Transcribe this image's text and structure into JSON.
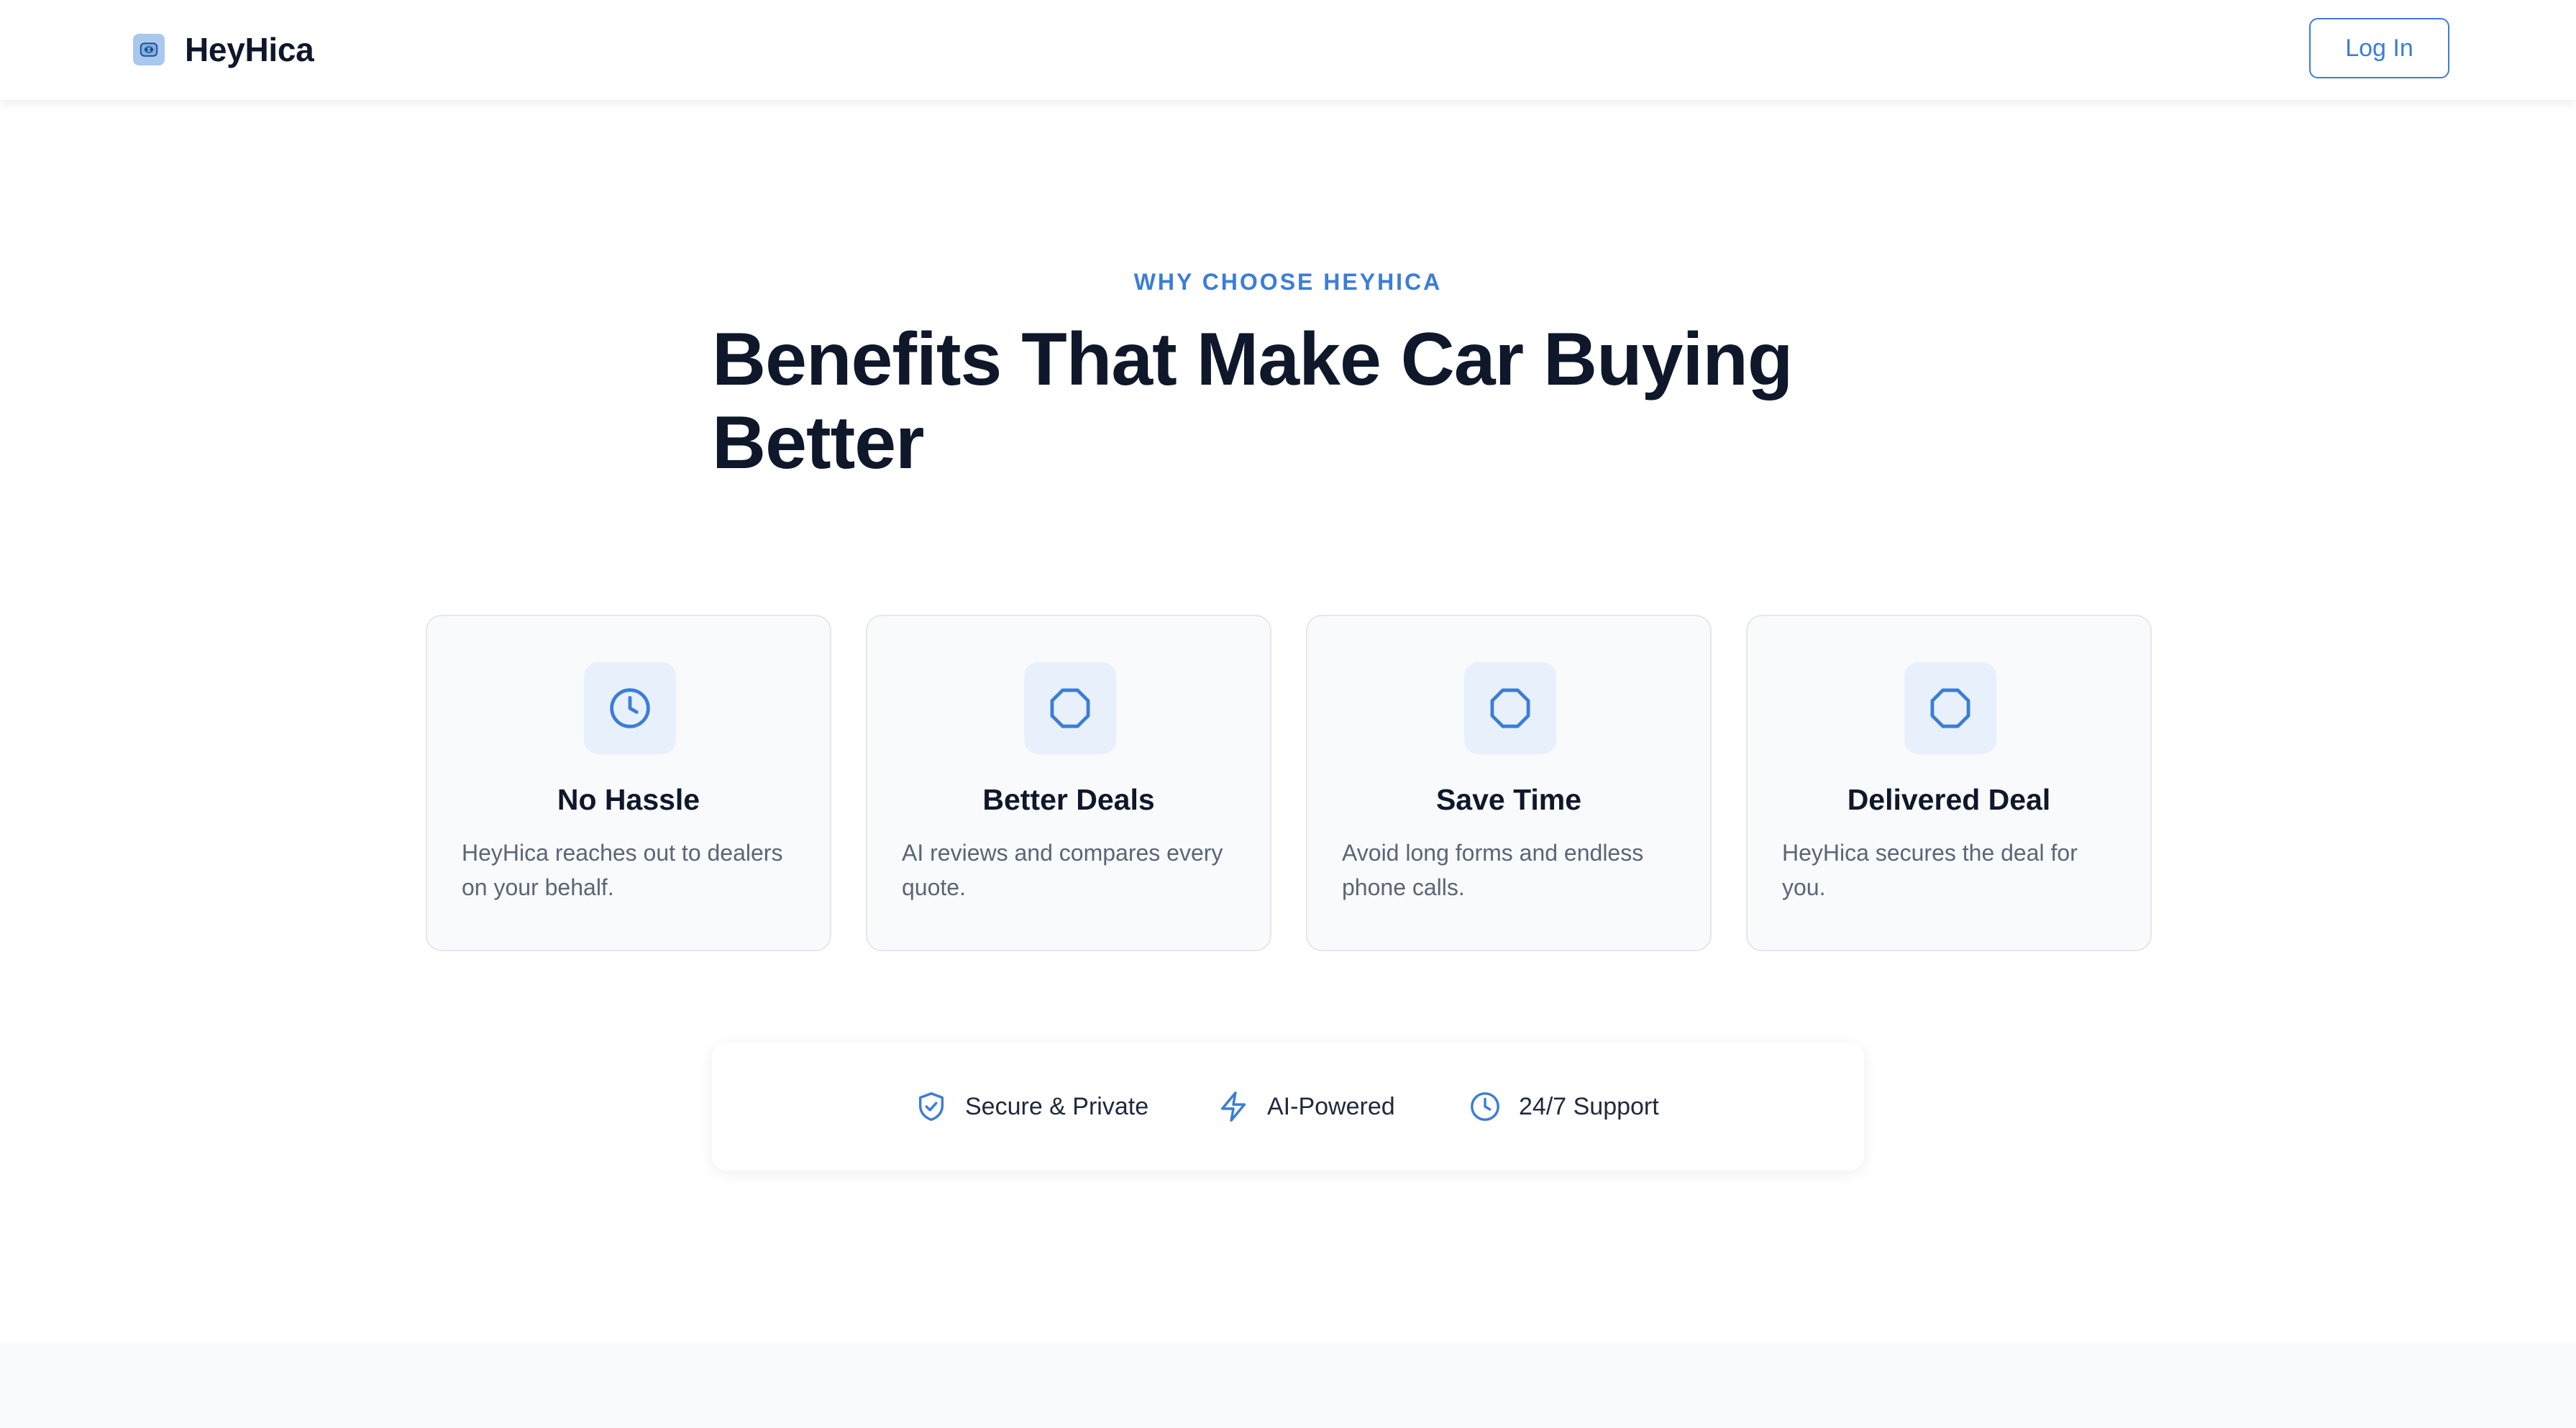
{
  "header": {
    "brand_name": "HeyHica",
    "login_label": "Log In"
  },
  "hero": {
    "eyebrow": "WHY CHOOSE HEYHICA",
    "headline_line1": "Benefits That Make Car Buying",
    "headline_line2": "Better"
  },
  "benefits": [
    {
      "icon": "clock-icon",
      "title": "No Hassle",
      "description": "HeyHica reaches out to dealers on your behalf."
    },
    {
      "icon": "octagon-icon",
      "title": "Better Deals",
      "description": "AI reviews and compares every quote."
    },
    {
      "icon": "octagon-icon",
      "title": "Save Time",
      "description": "Avoid long forms and endless phone calls."
    },
    {
      "icon": "octagon-icon",
      "title": "Delivered Deal",
      "description": "HeyHica secures the deal for you."
    }
  ],
  "features": [
    {
      "icon": "shield-check-icon",
      "label": "Secure & Private"
    },
    {
      "icon": "lightning-icon",
      "label": "AI-Powered"
    },
    {
      "icon": "clock-icon",
      "label": "24/7 Support"
    }
  ],
  "colors": {
    "accent": "#3b7dd8",
    "text_dark": "#0f172a",
    "text_muted": "#5b6577",
    "card_bg": "#f8fafc",
    "icon_bg": "#e8f0fc"
  }
}
